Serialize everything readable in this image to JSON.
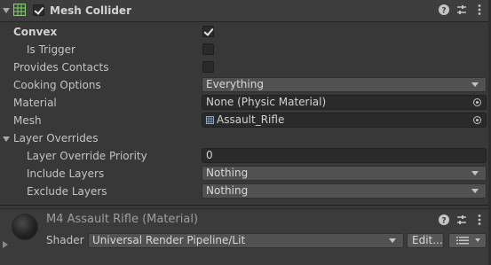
{
  "component": {
    "title": "Mesh Collider",
    "enabled": true,
    "icons": [
      "help-icon",
      "presets-icon",
      "more-icon"
    ]
  },
  "properties": {
    "convex": {
      "label": "Convex",
      "checked": true
    },
    "is_trigger": {
      "label": "Is Trigger",
      "checked": false
    },
    "provides_contacts": {
      "label": "Provides Contacts",
      "checked": false
    },
    "cooking_options": {
      "label": "Cooking Options",
      "value": "Everything"
    },
    "material": {
      "label": "Material",
      "value": "None (Physic Material)"
    },
    "mesh": {
      "label": "Mesh",
      "value": "Assault_Rifle"
    }
  },
  "layer_overrides": {
    "label": "Layer Overrides",
    "priority": {
      "label": "Layer Override Priority",
      "value": "0"
    },
    "include": {
      "label": "Include Layers",
      "value": "Nothing"
    },
    "exclude": {
      "label": "Exclude Layers",
      "value": "Nothing"
    }
  },
  "material_asset": {
    "title": "M4 Assault Rifle (Material)",
    "shader_label": "Shader",
    "shader_value": "Universal Render Pipeline/Lit",
    "edit_label": "Edit...",
    "list_icon": "list-icon"
  }
}
